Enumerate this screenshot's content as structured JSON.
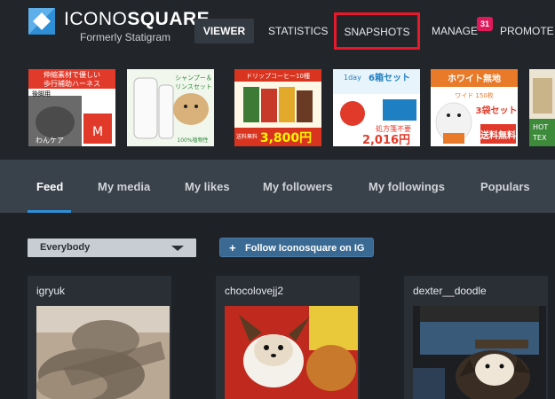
{
  "brand": {
    "name_light": "ICONO",
    "name_bold": "SQUARE",
    "subtitle": "Formerly Statigram"
  },
  "nav": {
    "viewer": "VIEWER",
    "statistics": "STATISTICS",
    "snapshots": "SNAPSHOTS",
    "manage": "MANAGE",
    "manage_badge": "31",
    "promote": "PROMOTE"
  },
  "ads": [
    {
      "lines": [
        "伸縮素材で優しい",
        "歩行補助ハーネス",
        "後脚用",
        "わんケア",
        "M"
      ]
    },
    {
      "lines": [
        "シャンプー＆",
        "リンスセット",
        "100%植物性"
      ]
    },
    {
      "lines": [
        "ドリップコーヒー10種",
        "送料無料",
        "3,800円"
      ]
    },
    {
      "lines": [
        "1day",
        "6箱セット",
        "処方箋不要",
        "2,016円"
      ]
    },
    {
      "lines": [
        "ホワイト無地",
        "ワイド 150枚",
        "3袋セット",
        "送料無料"
      ]
    },
    {
      "lines": [
        "HOT",
        "TEX"
      ]
    }
  ],
  "tabs": [
    "Feed",
    "My media",
    "My likes",
    "My followers",
    "My followings",
    "Populars"
  ],
  "filter": {
    "selected": "Everybody"
  },
  "follow_button": {
    "icon": "+",
    "label": "Follow Iconosquare on IG"
  },
  "cards": [
    {
      "username": "igryuk"
    },
    {
      "username": "chocolovejj2"
    },
    {
      "username": "dexter__doodle"
    }
  ],
  "colors": {
    "accent": "#2e8fd6",
    "highlight": "#e8192c",
    "badge": "#e0195b"
  }
}
